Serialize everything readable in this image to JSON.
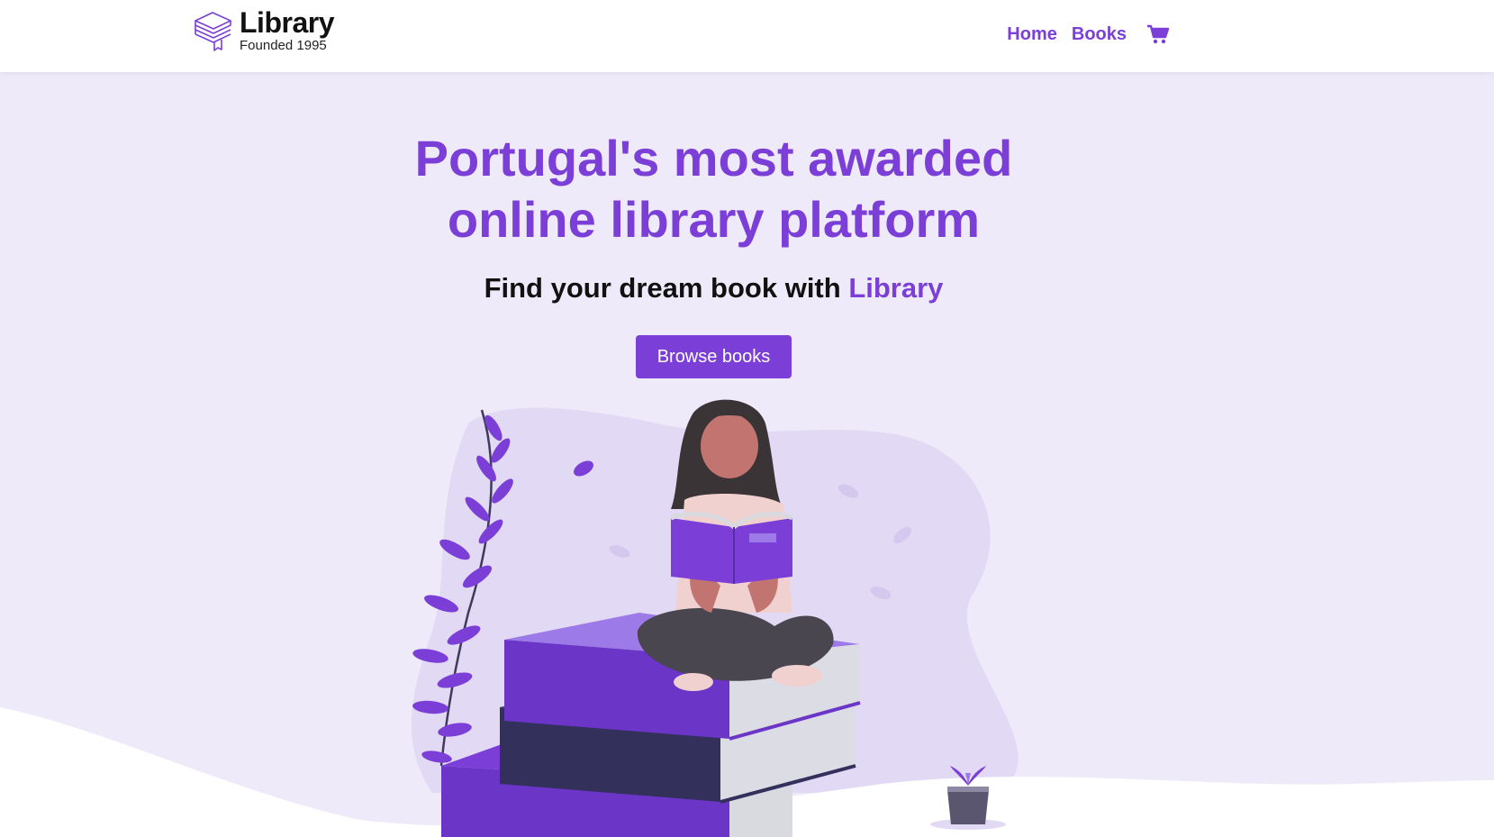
{
  "brand": {
    "title": "Library",
    "subtitle": "Founded 1995",
    "icon": "stacked-books-logo-icon"
  },
  "nav": {
    "items": [
      {
        "label": "Home"
      },
      {
        "label": "Books"
      }
    ],
    "cart_icon": "shopping-cart-icon"
  },
  "hero": {
    "title_line1": "Portugal's most awarded",
    "title_line2": "online library platform",
    "subtitle_prefix": "Find your dream book with ",
    "subtitle_accent": "Library",
    "cta_label": "Browse books"
  },
  "colors": {
    "accent": "#7b3fd8",
    "hero_background": "#efeafa",
    "navbar_background": "#ffffff"
  }
}
